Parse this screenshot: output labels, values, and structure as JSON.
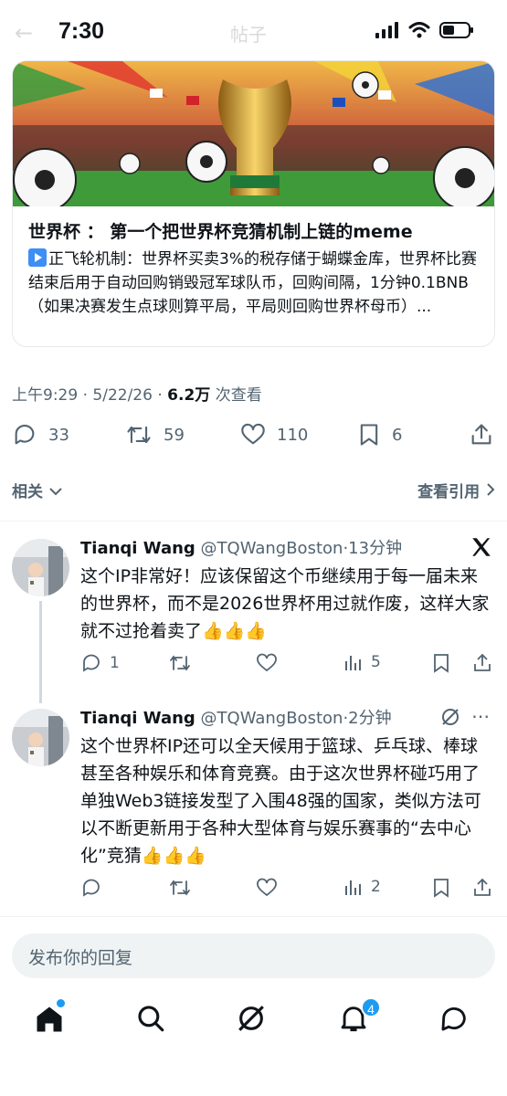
{
  "status": {
    "time": "7:30",
    "ghost_title": "帖子"
  },
  "card": {
    "title": "世界杯 ： 第一个把世界杯竞猜机制上链的meme",
    "description": "正飞轮机制：世界杯买卖3%的税存储于蝴蝶金库，世界杯比赛结束后用于自动回购销毁冠军球队币，回购间隔，1分钟0.1BNB（如果决赛发生点球则算平局，平局则回购世界杯母币）..."
  },
  "meta": {
    "time": "上午9:29",
    "date": "5/22/26",
    "views": "6.2万",
    "views_label": "次查看",
    "separator": "·"
  },
  "actions": {
    "replies": "33",
    "reposts": "59",
    "likes": "110",
    "bookmarks": "6"
  },
  "related": {
    "label": "相关",
    "quotes_label": "查看引用"
  },
  "replies": [
    {
      "name": "Tianqi Wang",
      "handle": "@TQWangBoston",
      "time": "13分钟",
      "text": "这个IP非常好！应该保留这个币继续用于每一届未来的世界杯，而不是2026世界杯用过就作废，这样大家就不过抢着卖了👍👍👍",
      "reply_count": "1",
      "view_count": "5"
    },
    {
      "name": "Tianqi Wang",
      "handle": "@TQWangBoston",
      "time": "2分钟",
      "text": "这个世界杯IP还可以全天候用于篮球、乒乓球、棒球甚至各种娱乐和体育竞赛。由于这次世界杯碰巧用了单独Web3链接发型了入围48强的国家，类似方法可以不断更新用于各种大型体育与娱乐赛事的“去中心化”竞猜👍👍👍",
      "reply_count": "",
      "view_count": "2"
    }
  ],
  "reply_input": {
    "placeholder": "发布你的回复"
  },
  "tabs": {
    "notifications_badge": "4"
  },
  "colors": {
    "accent": "#1d9bf0",
    "secondary_text": "#536471",
    "divider": "#eff3f4"
  }
}
